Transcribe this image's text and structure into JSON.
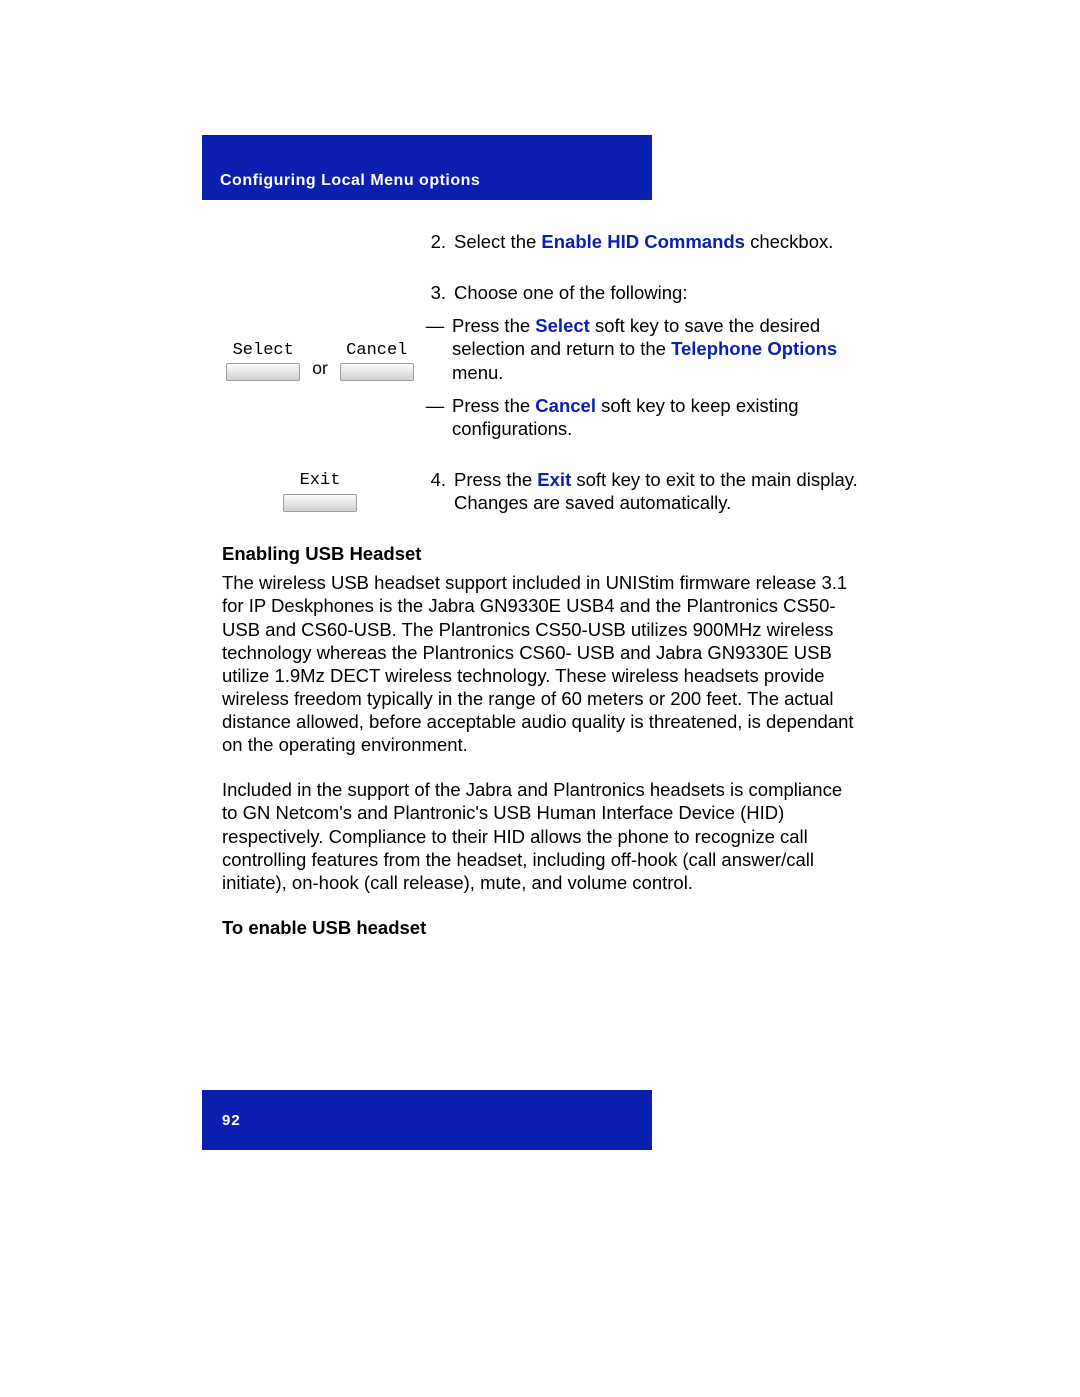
{
  "header": {
    "title": "Configuring Local Menu options"
  },
  "steps": {
    "s2": {
      "num": "2.",
      "pre": "Select the ",
      "term": "Enable HID Commands",
      "post": " checkbox."
    },
    "s3": {
      "num": "3.",
      "intro": "Choose one of the following:",
      "a_pre": "Press the ",
      "a_key": "Select",
      "a_mid": " soft key to save the desired selection and return to the ",
      "a_menu": "Telephone Options",
      "a_post": " menu.",
      "b_pre": "Press the ",
      "b_key": "Cancel",
      "b_post": " soft key to keep existing configurations."
    },
    "s4": {
      "num": "4.",
      "pre": "Press the ",
      "key": "Exit",
      "post": " soft key to exit to the main display. Changes are saved automatically."
    }
  },
  "keys": {
    "select": "Select",
    "cancel": "Cancel",
    "or": "or",
    "exit": "Exit"
  },
  "sections": {
    "h1": "Enabling USB Headset",
    "p1": "The wireless USB headset support included in UNIStim firmware release 3.1 for IP Deskphones is the Jabra GN9330E USB4 and the Plantronics CS50-USB and CS60-USB. The Plantronics CS50-USB utilizes 900MHz wireless technology whereas the Plantronics CS60- USB and Jabra GN9330E USB utilize 1.9Mz DECT wireless technology. These wireless headsets provide wireless freedom typically in the range of 60 meters or 200 feet. The actual distance allowed, before acceptable audio quality is threatened, is dependant on the operating environment.",
    "p2": "Included in the support of the Jabra and Plantronics headsets is compliance to GN Netcom's and Plantronic's USB Human Interface Device (HID) respectively. Compliance to their HID allows the phone to recognize call controlling features from the headset, including off-hook (call answer/call initiate), on-hook (call release), mute, and volume control.",
    "h2": "To enable USB headset"
  },
  "footer": {
    "page": "92"
  }
}
